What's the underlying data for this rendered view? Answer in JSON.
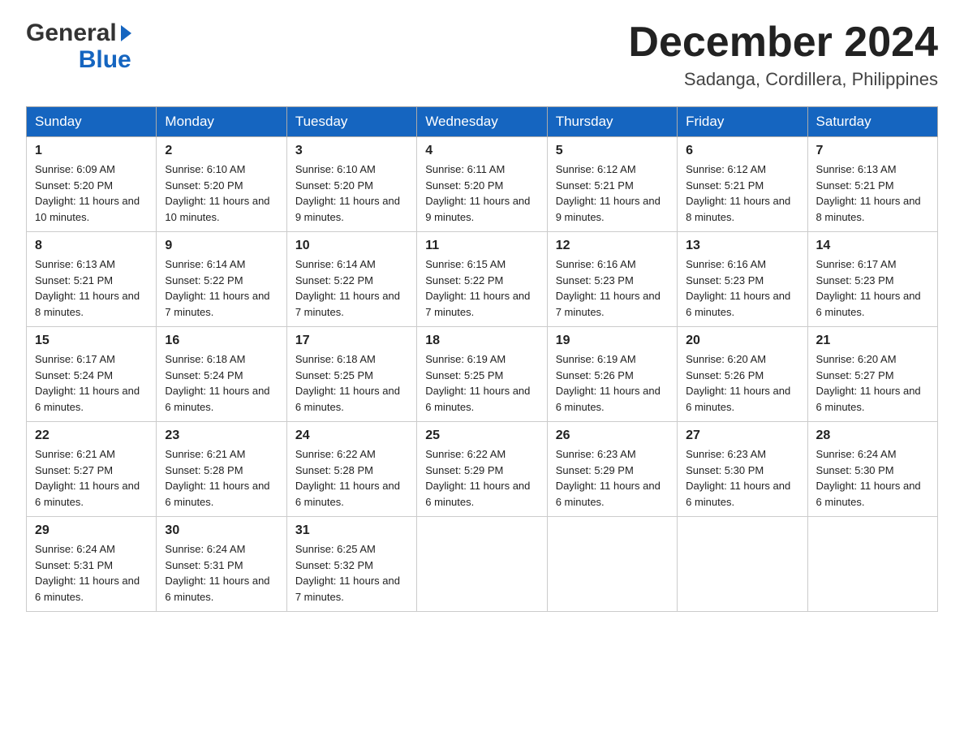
{
  "logo": {
    "general": "General",
    "blue": "Blue"
  },
  "title": "December 2024",
  "subtitle": "Sadanga, Cordillera, Philippines",
  "weekdays": [
    "Sunday",
    "Monday",
    "Tuesday",
    "Wednesday",
    "Thursday",
    "Friday",
    "Saturday"
  ],
  "weeks": [
    [
      {
        "day": "1",
        "sunrise": "6:09 AM",
        "sunset": "5:20 PM",
        "daylight": "11 hours and 10 minutes."
      },
      {
        "day": "2",
        "sunrise": "6:10 AM",
        "sunset": "5:20 PM",
        "daylight": "11 hours and 10 minutes."
      },
      {
        "day": "3",
        "sunrise": "6:10 AM",
        "sunset": "5:20 PM",
        "daylight": "11 hours and 9 minutes."
      },
      {
        "day": "4",
        "sunrise": "6:11 AM",
        "sunset": "5:20 PM",
        "daylight": "11 hours and 9 minutes."
      },
      {
        "day": "5",
        "sunrise": "6:12 AM",
        "sunset": "5:21 PM",
        "daylight": "11 hours and 9 minutes."
      },
      {
        "day": "6",
        "sunrise": "6:12 AM",
        "sunset": "5:21 PM",
        "daylight": "11 hours and 8 minutes."
      },
      {
        "day": "7",
        "sunrise": "6:13 AM",
        "sunset": "5:21 PM",
        "daylight": "11 hours and 8 minutes."
      }
    ],
    [
      {
        "day": "8",
        "sunrise": "6:13 AM",
        "sunset": "5:21 PM",
        "daylight": "11 hours and 8 minutes."
      },
      {
        "day": "9",
        "sunrise": "6:14 AM",
        "sunset": "5:22 PM",
        "daylight": "11 hours and 7 minutes."
      },
      {
        "day": "10",
        "sunrise": "6:14 AM",
        "sunset": "5:22 PM",
        "daylight": "11 hours and 7 minutes."
      },
      {
        "day": "11",
        "sunrise": "6:15 AM",
        "sunset": "5:22 PM",
        "daylight": "11 hours and 7 minutes."
      },
      {
        "day": "12",
        "sunrise": "6:16 AM",
        "sunset": "5:23 PM",
        "daylight": "11 hours and 7 minutes."
      },
      {
        "day": "13",
        "sunrise": "6:16 AM",
        "sunset": "5:23 PM",
        "daylight": "11 hours and 6 minutes."
      },
      {
        "day": "14",
        "sunrise": "6:17 AM",
        "sunset": "5:23 PM",
        "daylight": "11 hours and 6 minutes."
      }
    ],
    [
      {
        "day": "15",
        "sunrise": "6:17 AM",
        "sunset": "5:24 PM",
        "daylight": "11 hours and 6 minutes."
      },
      {
        "day": "16",
        "sunrise": "6:18 AM",
        "sunset": "5:24 PM",
        "daylight": "11 hours and 6 minutes."
      },
      {
        "day": "17",
        "sunrise": "6:18 AM",
        "sunset": "5:25 PM",
        "daylight": "11 hours and 6 minutes."
      },
      {
        "day": "18",
        "sunrise": "6:19 AM",
        "sunset": "5:25 PM",
        "daylight": "11 hours and 6 minutes."
      },
      {
        "day": "19",
        "sunrise": "6:19 AM",
        "sunset": "5:26 PM",
        "daylight": "11 hours and 6 minutes."
      },
      {
        "day": "20",
        "sunrise": "6:20 AM",
        "sunset": "5:26 PM",
        "daylight": "11 hours and 6 minutes."
      },
      {
        "day": "21",
        "sunrise": "6:20 AM",
        "sunset": "5:27 PM",
        "daylight": "11 hours and 6 minutes."
      }
    ],
    [
      {
        "day": "22",
        "sunrise": "6:21 AM",
        "sunset": "5:27 PM",
        "daylight": "11 hours and 6 minutes."
      },
      {
        "day": "23",
        "sunrise": "6:21 AM",
        "sunset": "5:28 PM",
        "daylight": "11 hours and 6 minutes."
      },
      {
        "day": "24",
        "sunrise": "6:22 AM",
        "sunset": "5:28 PM",
        "daylight": "11 hours and 6 minutes."
      },
      {
        "day": "25",
        "sunrise": "6:22 AM",
        "sunset": "5:29 PM",
        "daylight": "11 hours and 6 minutes."
      },
      {
        "day": "26",
        "sunrise": "6:23 AM",
        "sunset": "5:29 PM",
        "daylight": "11 hours and 6 minutes."
      },
      {
        "day": "27",
        "sunrise": "6:23 AM",
        "sunset": "5:30 PM",
        "daylight": "11 hours and 6 minutes."
      },
      {
        "day": "28",
        "sunrise": "6:24 AM",
        "sunset": "5:30 PM",
        "daylight": "11 hours and 6 minutes."
      }
    ],
    [
      {
        "day": "29",
        "sunrise": "6:24 AM",
        "sunset": "5:31 PM",
        "daylight": "11 hours and 6 minutes."
      },
      {
        "day": "30",
        "sunrise": "6:24 AM",
        "sunset": "5:31 PM",
        "daylight": "11 hours and 6 minutes."
      },
      {
        "day": "31",
        "sunrise": "6:25 AM",
        "sunset": "5:32 PM",
        "daylight": "11 hours and 7 minutes."
      },
      null,
      null,
      null,
      null
    ]
  ],
  "labels": {
    "sunrise_prefix": "Sunrise: ",
    "sunset_prefix": "Sunset: ",
    "daylight_prefix": "Daylight: "
  }
}
